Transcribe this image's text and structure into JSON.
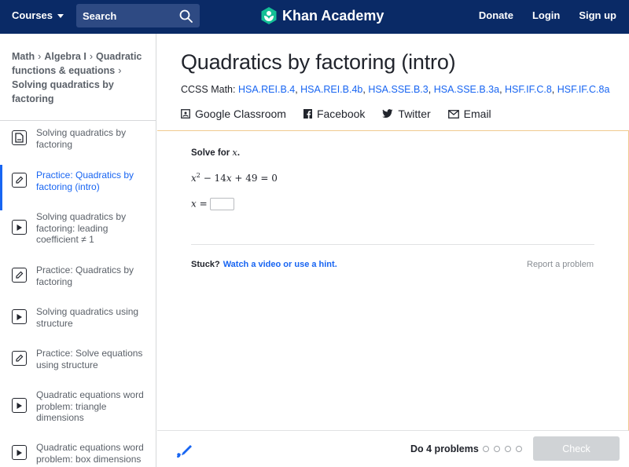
{
  "topnav": {
    "courses_label": "Courses",
    "search_placeholder": "Search",
    "logo_text": "Khan Academy",
    "donate_label": "Donate",
    "login_label": "Login",
    "signup_label": "Sign up"
  },
  "breadcrumb": {
    "items": [
      "Math",
      "Algebra I",
      "Quadratic functions & equations",
      "Solving quadratics by factoring"
    ]
  },
  "sidebar": {
    "items": [
      {
        "label": "Solving quadratics by factoring",
        "icon": "article-icon",
        "active": false
      },
      {
        "label": "Practice: Quadratics by factoring (intro)",
        "icon": "pencil-icon",
        "active": true
      },
      {
        "label": "Solving quadratics by factoring: leading coefficient ≠ 1",
        "icon": "play-icon",
        "active": false
      },
      {
        "label": "Practice: Quadratics by factoring",
        "icon": "pencil-icon",
        "active": false
      },
      {
        "label": "Solving quadratics using structure",
        "icon": "play-icon",
        "active": false
      },
      {
        "label": "Practice: Solve equations using structure",
        "icon": "pencil-icon",
        "active": false
      },
      {
        "label": "Quadratic equations word problem: triangle dimensions",
        "icon": "play-icon",
        "active": false
      },
      {
        "label": "Quadratic equations word problem: box dimensions",
        "icon": "play-icon",
        "active": false
      }
    ]
  },
  "main": {
    "title": "Quadratics by factoring (intro)",
    "ccss_prefix": "CCSS Math:",
    "ccss_links": [
      "HSA.REI.B.4",
      "HSA.REI.B.4b",
      "HSA.SSE.B.3",
      "HSA.SSE.B.3a",
      "HSF.IF.C.8",
      "HSF.IF.C.8a"
    ],
    "share": {
      "google_classroom": "Google Classroom",
      "facebook": "Facebook",
      "twitter": "Twitter",
      "email": "Email"
    }
  },
  "exercise": {
    "prompt_prefix": "Solve for ",
    "prompt_var": "x",
    "prompt_suffix": ".",
    "equation_terms": [
      "x",
      "2",
      " − 14",
      "x",
      " + 49 = 0"
    ],
    "answer_lhs": "x =",
    "answer_value": "",
    "stuck_label": "Stuck?",
    "hint_link": "Watch a video or use a hint.",
    "report_label": "Report a problem"
  },
  "footer": {
    "do_problems_label": "Do 4 problems",
    "progress_total": 4,
    "progress_done": 0,
    "check_label": "Check"
  },
  "colors": {
    "nav_bg": "#0a2a66",
    "link_blue": "#1865f2",
    "exercise_border": "#f0c98f",
    "check_disabled": "#d0d3d6",
    "logo_green": "#14bf96"
  }
}
